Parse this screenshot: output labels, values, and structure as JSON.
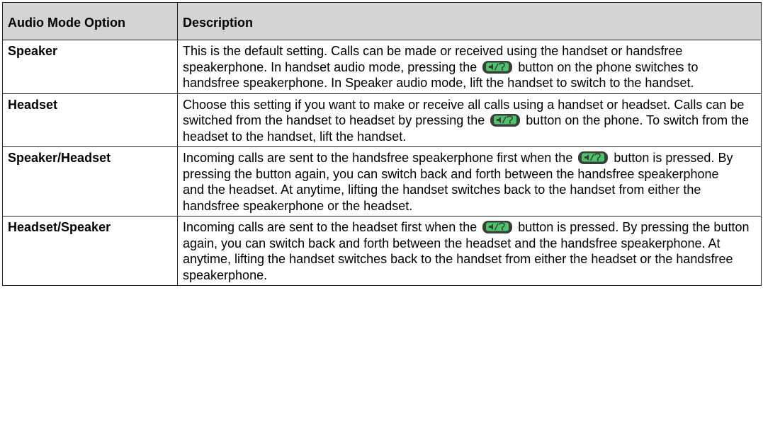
{
  "table": {
    "headers": [
      "Audio Mode Option",
      "Description"
    ],
    "rows": [
      {
        "option": "Speaker",
        "desc": [
          "This is the default setting. Calls can be made or received using the handset or handsfree speakerphone. In handset audio mode, pressing the",
          "button on the phone switches to handsfree speakerphone. In Speaker audio mode, lift the handset to switch to the handset."
        ]
      },
      {
        "option": "Headset",
        "desc": [
          "Choose this setting if you want to make or receive all calls using a handset or headset. Calls can be switched from the handset to headset by pressing the",
          "button on the phone. To switch from the headset to the handset, lift the handset."
        ]
      },
      {
        "option": "Speaker/Headset",
        "desc": [
          " Incoming calls are sent to the handsfree speakerphone first when the",
          "button is pressed. By pressing the button again, you can switch back and forth between the handsfree speakerphone and the headset. At anytime, lifting the handset switches back to the handset from either the handsfree speakerphone or the headset."
        ]
      },
      {
        "option": "Headset/Speaker",
        "desc": [
          "Incoming calls are sent to the headset first when the",
          "button is pressed. By pressing the button again, you can switch back and forth between the headset and the handsfree speakerphone. At anytime, lifting the handset switches back to the handset from either the headset or the handsfree speakerphone."
        ]
      }
    ]
  },
  "icons": {
    "speaker_button": "speaker-headset-button-icon"
  },
  "colors": {
    "header_bg": "#d4d4d4",
    "button_body": "#3a3f3a",
    "button_face": "#4cc46a"
  }
}
